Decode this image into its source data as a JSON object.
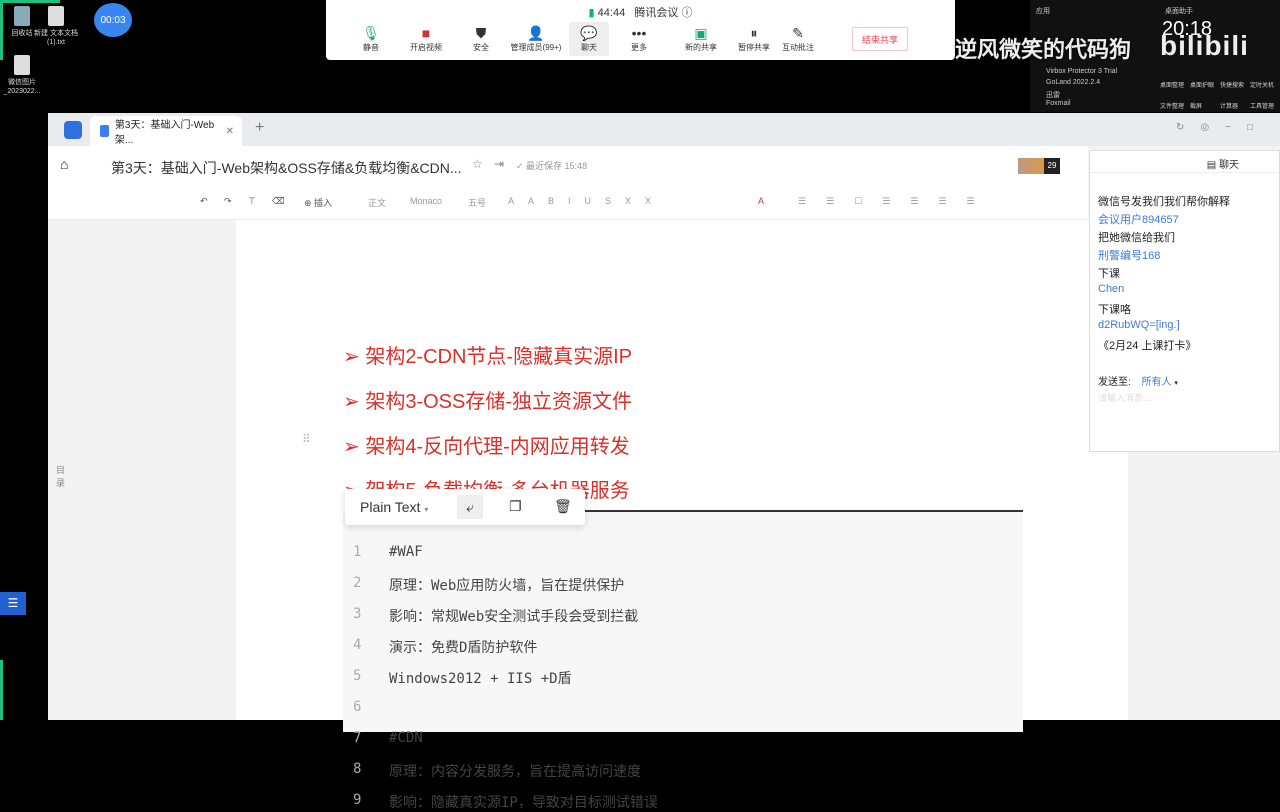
{
  "desktop": {
    "icons": [
      {
        "label": "回收站"
      },
      {
        "label": "新建 文本文档 (1).txt"
      },
      {
        "label": "微信图片_2023022..."
      }
    ],
    "timer": "00:03",
    "overlay_text": "逆风微笑的代码狗",
    "watermark": "bilibili",
    "clock": "20:18"
  },
  "system_panel": {
    "title_left": "应用",
    "title_right": "桌面助手",
    "apps": [
      "Virbox Protector 3 Trial",
      "GoLand 2022.2.4",
      "迅雷",
      "Foxmail"
    ],
    "tools": [
      "桌面整理",
      "桌面护眼",
      "快捷搜索",
      "定时关机",
      "文件整理",
      "截屏",
      "计算器",
      "工具管理"
    ]
  },
  "meeting": {
    "time": "44:44",
    "app": "腾讯会议",
    "buttons": [
      "静音",
      "开启视频",
      "安全",
      "管理成员(99+)",
      "聊天",
      "更多",
      "新的共享",
      "暂停共享",
      "互动批注"
    ],
    "end_label": "结束共享"
  },
  "browser": {
    "tab_title": "第3天：基础入门-Web架...",
    "doc_title": "第3天：基础入门-Web架构&OSS存储&负载均衡&CDN...",
    "save_status": "最近保存 15:48",
    "collab_count": "29",
    "toolbar": {
      "insert": "插入",
      "style": "正文",
      "font": "Monaco",
      "size": "五号"
    }
  },
  "sidebar": {
    "toc_label": "目录"
  },
  "doc": {
    "headings": [
      "➢ 架构2-CDN节点-隐藏真实源IP",
      "➢ 架构3-OSS存储-独立资源文件",
      "➢ 架构4-反向代理-内网应用转发",
      "➢ 架构5-负载均衡-多台机器服务"
    ],
    "code_lang": "Plain Text",
    "code_lines": [
      {
        "n": "1",
        "t": "#WAF"
      },
      {
        "n": "2",
        "t": "原理：Web应用防火墙，旨在提供保护"
      },
      {
        "n": "3",
        "t": "影响：常规Web安全测试手段会受到拦截"
      },
      {
        "n": "4",
        "t": "演示：免费D盾防护软件"
      },
      {
        "n": "5",
        "t": "Windows2012 + IIS +D盾"
      },
      {
        "n": "6",
        "t": ""
      },
      {
        "n": "7",
        "t": "#CDN"
      },
      {
        "n": "8",
        "t": "原理：内容分发服务，旨在提高访问速度"
      },
      {
        "n": "9",
        "t": "影响：隐藏真实源IP，导致对目标测试错误"
      }
    ]
  },
  "chat": {
    "title": "聊天",
    "messages": [
      {
        "t": "微信号发我们我们帮你解释",
        "c": "n"
      },
      {
        "t": "会议用户894657",
        "c": "b"
      },
      {
        "t": "把她微信给我们",
        "c": "n"
      },
      {
        "t": "刑警编号168",
        "c": "b"
      },
      {
        "t": "下课",
        "c": "n"
      },
      {
        "t": "Chen",
        "c": "b"
      },
      {
        "t": "下课咯",
        "c": "n"
      },
      {
        "t": "d2RubWQ=[ing.]",
        "c": "b"
      },
      {
        "t": "《2月24 上课打卡》",
        "c": "n"
      }
    ],
    "send_to_label": "发送至:",
    "send_to": "所有人",
    "input_placeholder": "请输入消息..."
  }
}
